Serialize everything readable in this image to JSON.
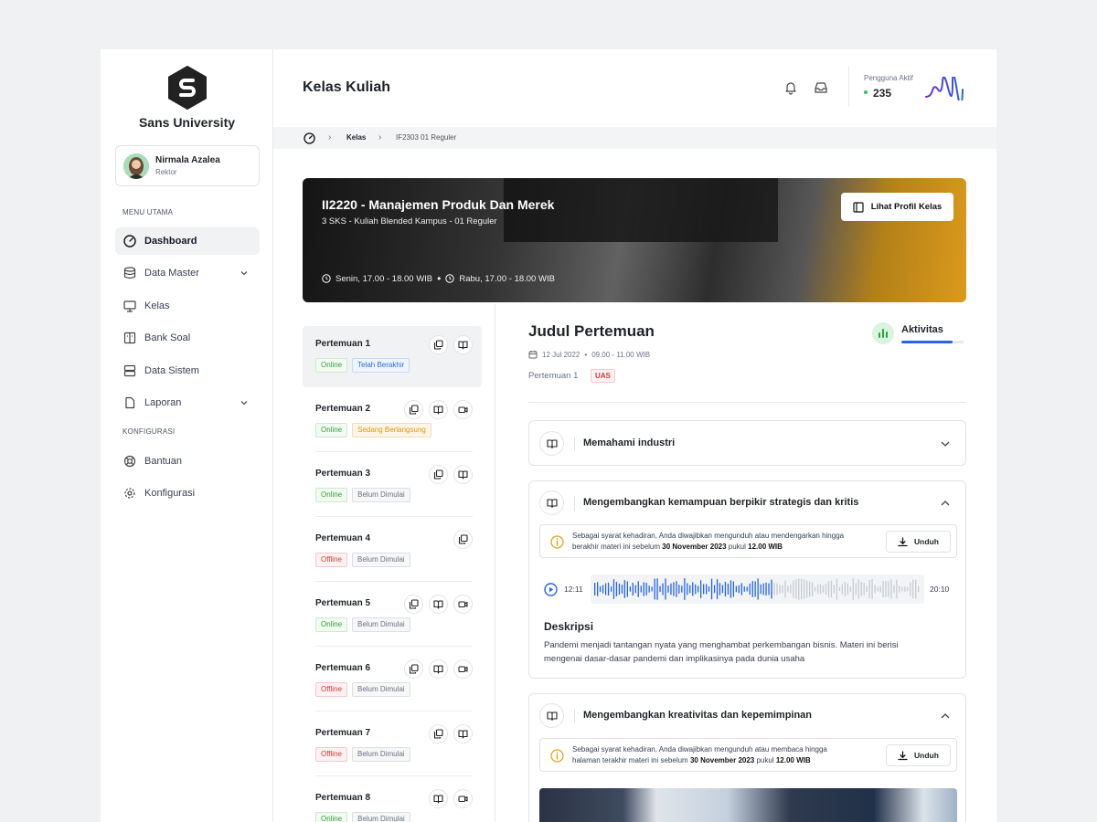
{
  "sidebar": {
    "brand": "Sans University",
    "user": {
      "name": "Nirmala Azalea",
      "role": "Rektor"
    },
    "sections": {
      "main": "MENU UTAMA",
      "config": "KONFIGURASI"
    },
    "items": [
      {
        "label": "Dashboard",
        "icon": "gauge-icon",
        "active": true
      },
      {
        "label": "Data Master",
        "icon": "database-icon",
        "dropdown": true
      },
      {
        "label": "Kelas",
        "icon": "presentation-icon"
      },
      {
        "label": "Bank Soal",
        "icon": "book-columns-icon"
      },
      {
        "label": "Data Sistem",
        "icon": "server-icon"
      },
      {
        "label": "Laporan",
        "icon": "document-icon",
        "dropdown": true
      },
      {
        "label": "Bantuan",
        "icon": "lifebuoy-icon"
      },
      {
        "label": "Konfigurasi",
        "icon": "gear-icon"
      }
    ]
  },
  "header": {
    "title": "Kelas Kuliah",
    "active_users_label": "Pengguna Aktif",
    "active_users_value": "235"
  },
  "breadcrumb": {
    "items": [
      "Kelas",
      "IF2303 01 Reguler"
    ]
  },
  "banner": {
    "title": "II2220 - Manajemen Produk Dan Merek",
    "subtitle": "3 SKS - Kuliah Blended Kampus - 01 Reguler",
    "schedule1": "Senin, 17.00 - 18.00 WIB",
    "schedule2": "Rabu, 17.00 - 18.00 WIB",
    "button": "Lihat Profil Kelas"
  },
  "meetings": [
    {
      "title": "Pertemuan 1",
      "mode": "Online",
      "status": "Telah Berakhir"
    },
    {
      "title": "Pertemuan 2",
      "mode": "Online",
      "status": "Sedang Berlangsung"
    },
    {
      "title": "Pertemuan 3",
      "mode": "Online",
      "status": "Belum Dimulai"
    },
    {
      "title": "Pertemuan 4",
      "mode": "Offline",
      "status": "Belum Dimulai"
    },
    {
      "title": "Pertemuan 5",
      "mode": "Online",
      "status": "Belum Dimulai"
    },
    {
      "title": "Pertemuan 6",
      "mode": "Offline",
      "status": "Belum Dimulai"
    },
    {
      "title": "Pertemuan 7",
      "mode": "Offline",
      "status": "Belum Dimulai"
    },
    {
      "title": "Pertemuan 8",
      "mode": "Online",
      "status": "Belum Dimulai"
    }
  ],
  "detail": {
    "title": "Judul Pertemuan",
    "date": "12 Jul 2022",
    "time": "09.00 - 11.00 WIB",
    "meeting": "Pertemuan 1",
    "badge": "UAS",
    "activity_label": "Aktivitas",
    "activity_progress": 0.83,
    "topics": [
      {
        "title": "Memahami industri"
      },
      {
        "title": "Mengembangkan kemampuan berpikir strategis dan kritis",
        "notice_pre": "Sebagai syarat kehadiran, Anda diwajibkan mengunduh atau mendengarkan hingga berakhir materi ini sebelum",
        "notice_date": "30 November 2023",
        "notice_mid": "pukul",
        "notice_time": "12.00 WIB",
        "download": "Unduh",
        "audio_current": "12:11",
        "audio_total": "20:10",
        "desc_heading": "Deskripsi",
        "desc": "Pandemi menjadi tantangan nyata yang menghambat perkembangan bisnis. Materi ini berisi mengenai dasar-dasar pandemi dan implikasinya pada dunia usaha"
      },
      {
        "title": "Mengembangkan kreativitas dan kepemimpinan",
        "notice_pre": "Sebagai syarat kehadiran, Anda diwajibkan mengunduh atau membaca hingga halaman terakhir materi ini sebelum",
        "notice_date": "30 November 2023",
        "notice_mid": "pukul",
        "notice_time": "12.00 WIB",
        "download": "Unduh"
      }
    ]
  },
  "colors": {
    "accent": "#2563eb",
    "online": "#3a9d3a",
    "offline": "#d23b3b",
    "running": "#e0970f",
    "done": "#2f6fd6"
  }
}
